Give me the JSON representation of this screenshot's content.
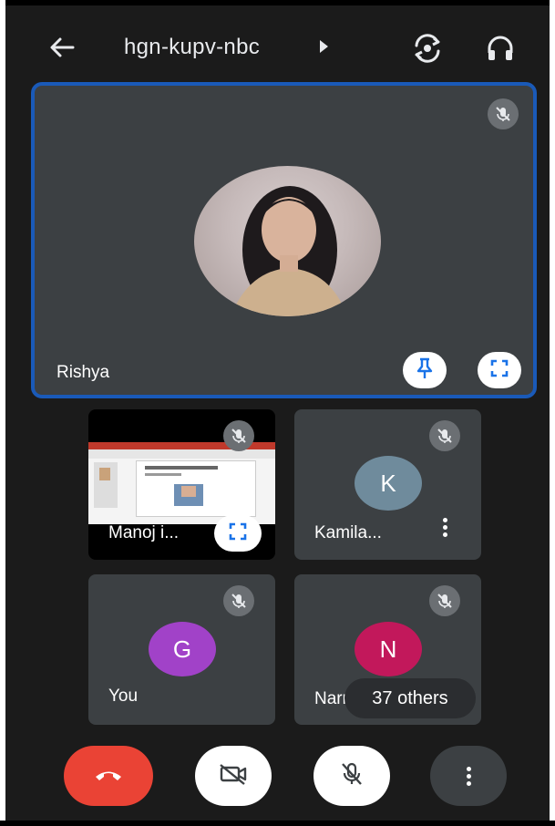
{
  "header": {
    "back_icon": "arrow-back-icon",
    "meeting_code": "hgn-kupv-nbc",
    "meeting_info_icon": "caret-right-icon",
    "switch_camera_icon": "flip-camera-icon",
    "audio_icon": "headphones-icon"
  },
  "main_tile": {
    "name": "Rishya",
    "mic_icon": "mic-off-icon",
    "pin_icon": "pin-icon",
    "fullscreen_icon": "fullscreen-icon"
  },
  "tiles": [
    {
      "name": "Manoj i...",
      "mic_icon": "mic-off-icon",
      "fullscreen_icon": "fullscreen-icon"
    },
    {
      "name": "Kamila...",
      "initial": "K",
      "avatar_color": "#6f8b9c",
      "mic_icon": "mic-off-icon",
      "menu_icon": "more-vertical-icon"
    },
    {
      "name": "You",
      "initial": "G",
      "avatar_color": "#a142c8",
      "mic_icon": "mic-off-icon"
    },
    {
      "name": "Narr",
      "initial": "N",
      "avatar_color": "#c2185b",
      "mic_icon": "mic-off-icon"
    }
  ],
  "others": {
    "label": "37 others"
  },
  "controls": {
    "end_call_icon": "end-call-icon",
    "end_call_color": "#ea4335",
    "camera_icon": "video-off-icon",
    "mic_icon": "mic-off-icon",
    "more_icon": "more-vertical-icon"
  }
}
